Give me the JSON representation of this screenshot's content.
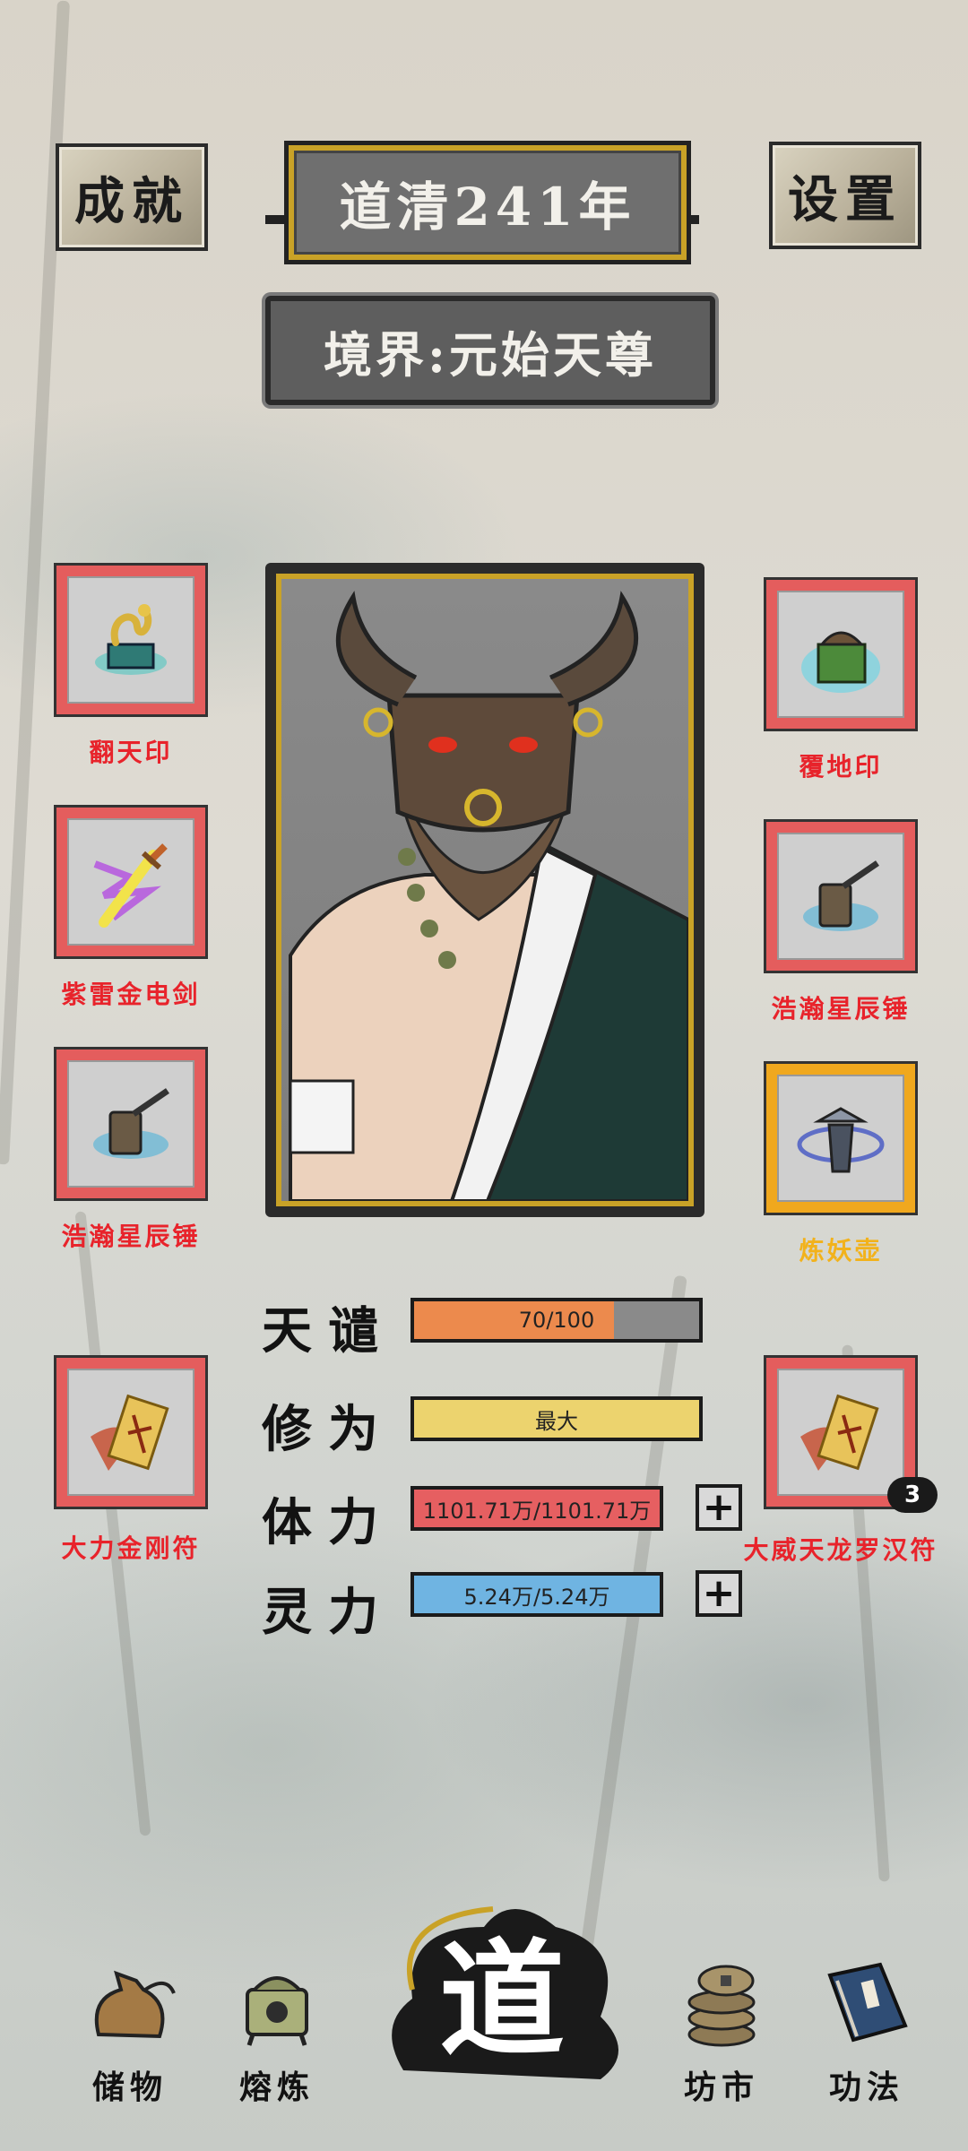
{
  "header": {
    "achievement_label": "成就",
    "settings_label": "设置",
    "year": "道清241年",
    "realm": "境界:元始天尊"
  },
  "left_items": [
    {
      "label": "翻天印",
      "icon": "jade-seal-dragon-icon"
    },
    {
      "label": "紫雷金电剑",
      "icon": "lightning-sword-icon"
    },
    {
      "label": "浩瀚星辰锤",
      "icon": "star-hammer-icon"
    }
  ],
  "right_items": [
    {
      "label": "覆地印",
      "icon": "earth-seal-icon"
    },
    {
      "label": "浩瀚星辰锤",
      "icon": "star-hammer-icon"
    },
    {
      "label": "炼妖壶",
      "icon": "demon-refining-pot-icon"
    }
  ],
  "talismans": {
    "left": {
      "label": "大力金刚符",
      "icon": "talisman-scroll-icon"
    },
    "right": {
      "label": "大威天龙罗汉符",
      "icon": "talisman-scroll-icon",
      "count": "3"
    }
  },
  "stats": {
    "tribulation": {
      "label": "天谴",
      "text": "70/100",
      "fill": 0.7,
      "color": "#ec8a4d"
    },
    "cultivation": {
      "label": "修为",
      "text": "最大",
      "fill": 1.0,
      "color": "#ecd36e"
    },
    "stamina": {
      "label": "体力",
      "text": "1101.71万/1101.71万",
      "fill": 1.0,
      "color": "#e65f61"
    },
    "spirit": {
      "label": "灵力",
      "text": "5.24万/5.24万",
      "fill": 1.0,
      "color": "#6fb4e2"
    },
    "plus_symbol": "+"
  },
  "nav": {
    "storage": "储物",
    "smelting": "熔炼",
    "dao": "道",
    "market": "坊市",
    "skills": "功法"
  },
  "colors": {
    "red_label": "#e8232b",
    "gold_label": "#f2b21b",
    "slot_red": "#e45d5d",
    "slot_gold": "#f0a81e"
  }
}
